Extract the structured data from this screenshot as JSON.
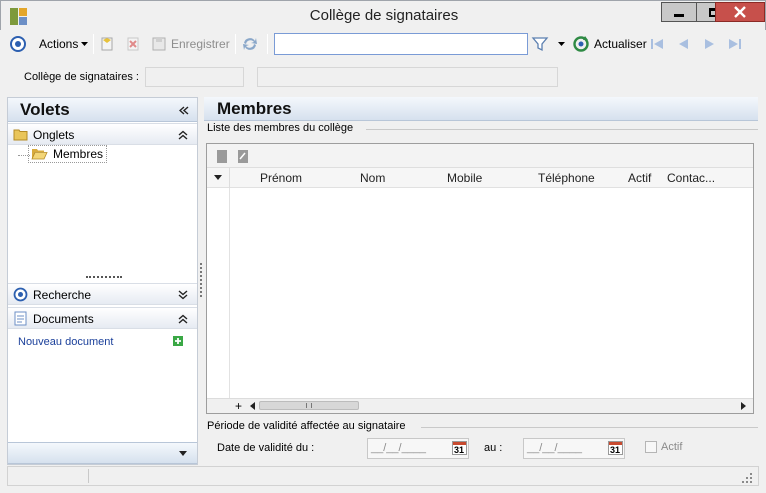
{
  "window": {
    "title": "Collège de signataires"
  },
  "toolbar": {
    "actions_label": "Actions",
    "save_label": "Enregistrer",
    "search_value": "",
    "refresh_label": "Actualiser"
  },
  "college": {
    "label": "Collège de signataires :",
    "field1_value": "",
    "field2_value": ""
  },
  "left_pane": {
    "title": "Volets",
    "groups": {
      "tabs_label": "Onglets",
      "tree_item_label": "Membres",
      "search_label": "Recherche",
      "documents_label": "Documents",
      "new_document_label": "Nouveau document"
    }
  },
  "main": {
    "title": "Membres",
    "members_group_label": "Liste des membres du collège",
    "columns": [
      "Prénom",
      "Nom",
      "Mobile",
      "Téléphone",
      "Actif",
      "Contac..."
    ],
    "rows": [],
    "validity_group_label": "Période de validité affectée au signataire",
    "validity_from_label": "Date de validité du :",
    "validity_from_value": "__/__/____",
    "validity_to_label": "au :",
    "validity_to_value": "__/__/____",
    "calendar_day": "31",
    "active_label": "Actif",
    "active_checked": false
  },
  "colors": {
    "accent": "#2c5fb0",
    "link": "#1a3f9a",
    "pane_gradient_start": "#f4f8fc",
    "pane_gradient_end": "#d6e1ee",
    "close_red": "#c7504b"
  },
  "icons": {
    "app": "app-icon",
    "actions": "target-icon",
    "new_record": "new-record-icon",
    "delete": "delete-icon",
    "save": "save-icon",
    "sync": "sync-icon",
    "filter": "filter-icon",
    "refresh": "refresh-icon",
    "folder": "folder-icon",
    "document": "document-icon",
    "add": "add-icon",
    "calendar": "calendar-icon"
  }
}
